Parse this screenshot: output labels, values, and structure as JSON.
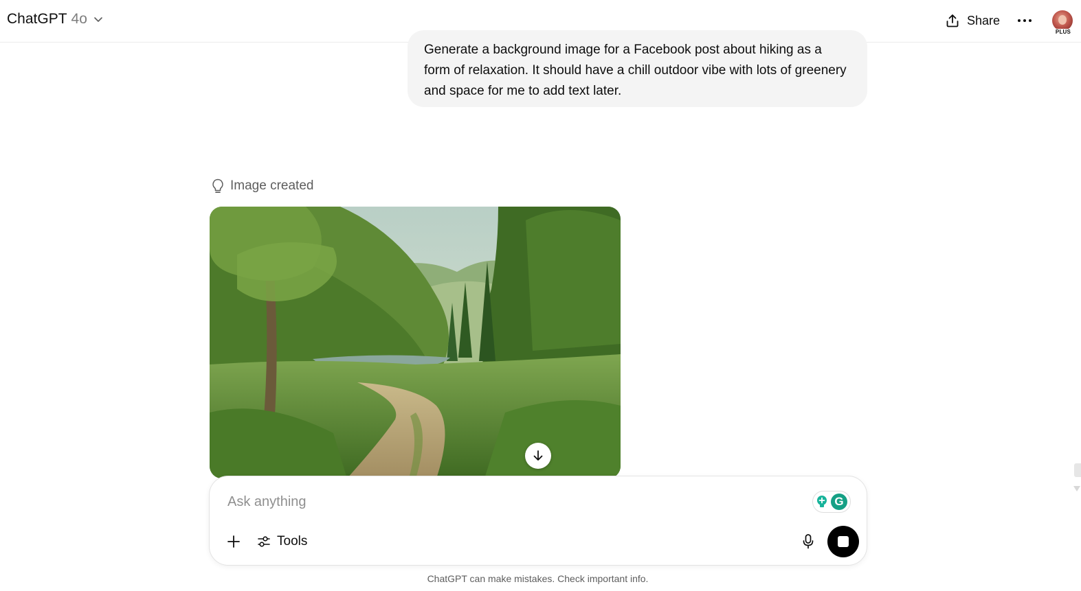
{
  "header": {
    "app_name": "ChatGPT",
    "model_name": "4o",
    "share_label": "Share",
    "plan_badge": "PLUS"
  },
  "conversation": {
    "user_message": "Generate a background image for a Facebook post about hiking as a form of relaxation. It should have a chill outdoor vibe with lots of greenery and space for me to add text later.",
    "assistant_status": "Image created"
  },
  "composer": {
    "placeholder": "Ask anything",
    "tools_label": "Tools",
    "grammarly_letter": "G"
  },
  "footer": {
    "disclaimer": "ChatGPT can make mistakes. Check important info."
  },
  "icons": {
    "model_chevron": "chevron-down-icon",
    "share": "upload-icon",
    "more": "ellipsis-icon",
    "status": "lightbulb-icon",
    "download": "arrow-down-icon",
    "add": "plus-icon",
    "tools": "sliders-icon",
    "mic": "microphone-icon",
    "stop": "stop-icon"
  },
  "colors": {
    "user_bubble": "#f4f4f4",
    "stop_button": "#000000",
    "grammarly": "#15a085"
  }
}
